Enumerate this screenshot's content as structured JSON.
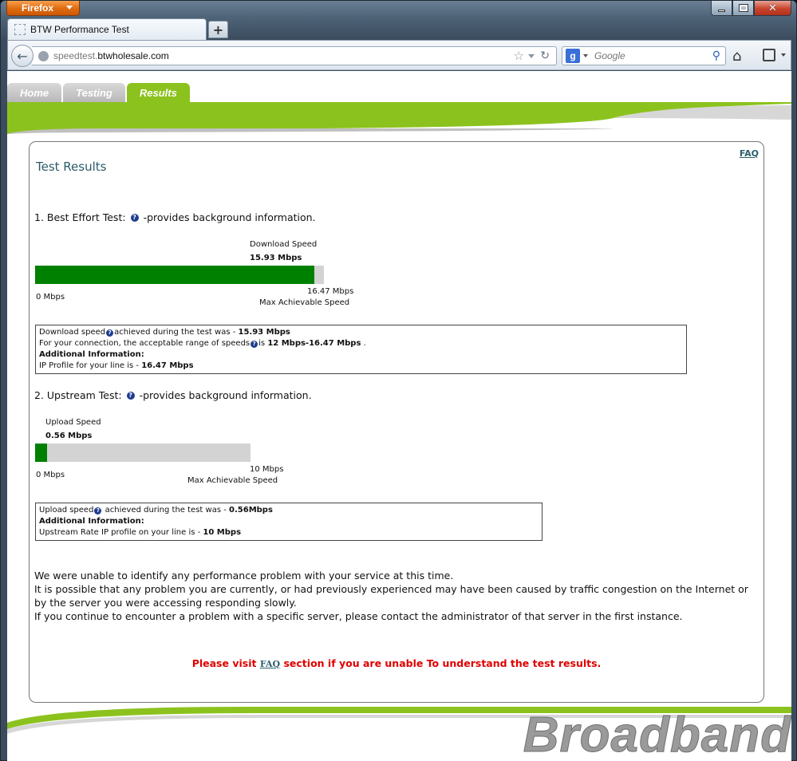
{
  "browser": {
    "app_button": "Firefox",
    "tab_title": "BTW Performance Test",
    "url_host": "speedtest.",
    "url_domain": "btwholesale.com",
    "search_placeholder": "Google",
    "search_engine_letter": "g"
  },
  "nav": {
    "tabs": [
      {
        "label": "Home"
      },
      {
        "label": "Testing"
      },
      {
        "label": "Results"
      }
    ],
    "active_tab": "Results"
  },
  "results": {
    "faq_link": "FAQ",
    "title": "Test Results",
    "best_effort": {
      "heading_prefix": "1. Best Effort Test:",
      "heading_suffix": "-provides background information.",
      "speed_label": "Download Speed",
      "speed_value": "15.93 Mbps",
      "min_label": "0 Mbps",
      "max_value": "16.47 Mbps",
      "max_label": "Max Achievable Speed",
      "fill_fraction": 0.9672,
      "info": {
        "line1_prefix": "Download speed",
        "line1_mid": "achieved during the test was - ",
        "line1_value": "15.93 Mbps",
        "line2_prefix": "For your connection, the acceptable range of speeds",
        "line2_mid": "is ",
        "line2_value": "12 Mbps-16.47 Mbps",
        "line2_suffix": " .",
        "line3": "Additional Information:",
        "line4_prefix": "IP Profile for your line is - ",
        "line4_value": "16.47 Mbps"
      }
    },
    "upstream": {
      "heading_prefix": "2. Upstream Test:",
      "heading_suffix": "-provides background information.",
      "speed_label": "Upload Speed",
      "speed_value": "0.56 Mbps",
      "min_label": "0 Mbps",
      "max_value": "10 Mbps",
      "max_label": "Max Achievable Speed",
      "fill_fraction": 0.056,
      "info": {
        "line1_prefix": "Upload speed",
        "line1_mid": " achieved during the test was - ",
        "line1_value": "0.56Mbps",
        "line2": "Additional Information:",
        "line3_prefix": "Upstream Rate IP profile on your line is - ",
        "line3_value": "10 Mbps"
      }
    },
    "summary": [
      "We were unable to identify any performance problem with your service at this time.",
      "It is possible that any problem you are currently, or had previously experienced may have been caused by traffic congestion on the Internet or by the server you were accessing responding slowly.",
      "If you continue to encounter a problem with a specific server, please contact the administrator of that server in the first instance."
    ],
    "visit": {
      "prefix": "Please visit ",
      "link": "FAQ",
      "suffix": " section if you are unable To understand the test results."
    }
  },
  "footer": {
    "brand": "Broadband"
  },
  "colors": {
    "accent_green": "#8cc21e",
    "bar_green": "#008000",
    "bar_track": "#d3d3d3",
    "alert_red": "#e00000",
    "title_teal": "#2c5b6a"
  }
}
